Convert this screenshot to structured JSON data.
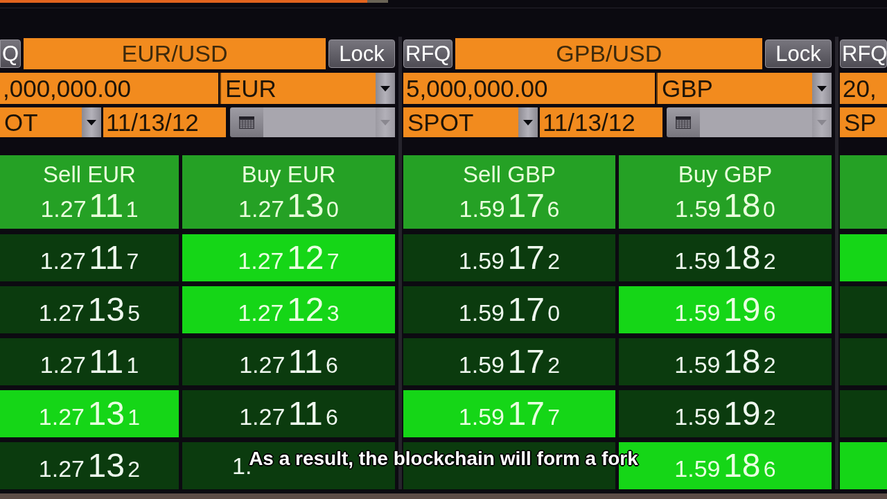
{
  "panels": [
    {
      "rfq": "Q",
      "pair": "EUR/USD",
      "lock": "Lock",
      "amount": ",000,000.00",
      "currency": "EUR",
      "tenor": "OT",
      "date": "11/13/12",
      "calendar_field": {
        "disabled": true
      },
      "quote": {
        "cells": [
          {
            "label": "Sell EUR",
            "big_figure": "1.27",
            "pips": "11",
            "fraction": "1"
          },
          {
            "label": "Buy EUR",
            "big_figure": "1.27",
            "pips": "13",
            "fraction": "0"
          }
        ]
      },
      "rows": [
        {
          "cells": [
            {
              "big_figure": "1.27",
              "pips": "11",
              "fraction": "7",
              "highlighted": false
            },
            {
              "big_figure": "1.27",
              "pips": "12",
              "fraction": "7",
              "highlighted": true
            }
          ]
        },
        {
          "cells": [
            {
              "big_figure": "1.27",
              "pips": "13",
              "fraction": "5",
              "highlighted": false
            },
            {
              "big_figure": "1.27",
              "pips": "12",
              "fraction": "3",
              "highlighted": true
            }
          ]
        },
        {
          "cells": [
            {
              "big_figure": "1.27",
              "pips": "11",
              "fraction": "1",
              "highlighted": false
            },
            {
              "big_figure": "1.27",
              "pips": "11",
              "fraction": "6",
              "highlighted": false
            }
          ]
        },
        {
          "cells": [
            {
              "big_figure": "1.27",
              "pips": "13",
              "fraction": "1",
              "highlighted": true
            },
            {
              "big_figure": "1.27",
              "pips": "11",
              "fraction": "6",
              "highlighted": false
            }
          ]
        },
        {
          "cells": [
            {
              "big_figure": "1.27",
              "pips": "13",
              "fraction": "2",
              "highlighted": false
            },
            {
              "big_figure": "1.",
              "highlighted": false
            }
          ]
        }
      ]
    },
    {
      "rfq": "RFQ",
      "pair": "GPB/USD",
      "lock": "Lock",
      "amount": "5,000,000.00",
      "currency": "GBP",
      "tenor": "SPOT",
      "date": "11/13/12",
      "calendar_field": {
        "disabled": true
      },
      "quote": {
        "cells": [
          {
            "label": "Sell GBP",
            "big_figure": "1.59",
            "pips": "17",
            "fraction": "6"
          },
          {
            "label": "Buy GBP",
            "big_figure": "1.59",
            "pips": "18",
            "fraction": "0"
          }
        ]
      },
      "rows": [
        {
          "cells": [
            {
              "big_figure": "1.59",
              "pips": "17",
              "fraction": "2",
              "highlighted": false
            },
            {
              "big_figure": "1.59",
              "pips": "18",
              "fraction": "2",
              "highlighted": false
            }
          ]
        },
        {
          "cells": [
            {
              "big_figure": "1.59",
              "pips": "17",
              "fraction": "0",
              "highlighted": false
            },
            {
              "big_figure": "1.59",
              "pips": "19",
              "fraction": "6",
              "highlighted": true
            }
          ]
        },
        {
          "cells": [
            {
              "big_figure": "1.59",
              "pips": "17",
              "fraction": "2",
              "highlighted": false
            },
            {
              "big_figure": "1.59",
              "pips": "18",
              "fraction": "2",
              "highlighted": false
            }
          ]
        },
        {
          "cells": [
            {
              "big_figure": "1.59",
              "pips": "17",
              "fraction": "7",
              "highlighted": true
            },
            {
              "big_figure": "1.59",
              "pips": "19",
              "fraction": "2",
              "highlighted": false
            }
          ]
        },
        {
          "cells": [
            {
              "highlighted": false
            },
            {
              "big_figure": "1.59",
              "pips": "18",
              "fraction": "6",
              "highlighted": true
            }
          ]
        }
      ]
    },
    {
      "rfq": "RFQ",
      "amount": "20,",
      "tenor": "SP",
      "rows": [
        {
          "cells": [
            {
              "highlighted": true
            }
          ]
        },
        {
          "cells": [
            {
              "highlighted": false
            }
          ]
        },
        {
          "cells": [
            {
              "highlighted": false
            }
          ]
        },
        {
          "cells": [
            {
              "highlighted": false
            }
          ]
        },
        {
          "cells": [
            {
              "highlighted": true
            }
          ]
        }
      ]
    }
  ],
  "caption": "As a result, the blockchain will form a fork"
}
